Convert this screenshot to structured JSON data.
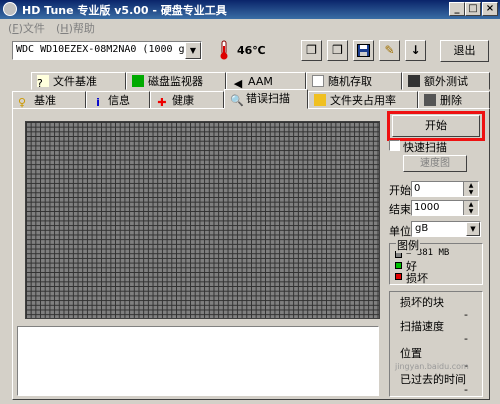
{
  "window": {
    "title": "HD Tune 专业版 v5.00 - 硬盘专业工具",
    "minimize": "_",
    "maximize": "□",
    "close": "×"
  },
  "menu": {
    "file": "文件",
    "help": "帮助"
  },
  "toolbar": {
    "drive": "WDC WD10EZEX-08M2NA0 (1000 gB)",
    "temperature": "46℃",
    "exit_label": "退出"
  },
  "tabs_top": [
    {
      "label": "文件基准"
    },
    {
      "label": "磁盘监视器"
    },
    {
      "label": "AAM"
    },
    {
      "label": "随机存取"
    },
    {
      "label": "额外测试"
    }
  ],
  "tabs_bottom": [
    {
      "label": "基准"
    },
    {
      "label": "信息"
    },
    {
      "label": "健康"
    },
    {
      "label": "错误扫描"
    },
    {
      "label": "文件夹占用率"
    },
    {
      "label": "删除"
    }
  ],
  "scan_panel": {
    "start_label": "开始",
    "quick_scan_label": "快速扫描",
    "map_label": "速度图",
    "start_field_label": "开始",
    "start_value": "0",
    "end_field_label": "结束",
    "end_value": "1000",
    "unit_label": "单位",
    "unit_value": "gB",
    "legend_title": "图例",
    "legend_block": "= 381 MB",
    "legend_ok": "好",
    "legend_bad": "损坏",
    "damaged_blocks_label": "损坏的块",
    "damaged_blocks_value": "-",
    "scan_speed_label": "扫描速度",
    "scan_speed_value": "-",
    "position_label": "位置",
    "position_value": "-",
    "elapsed_label": "已过去的时间",
    "elapsed_value": "-"
  },
  "colors": {
    "ok": "#00c000",
    "bad": "#e00000",
    "block": "#808080",
    "highlight": "#e11111"
  },
  "watermark": "jingyan.baidu.com"
}
